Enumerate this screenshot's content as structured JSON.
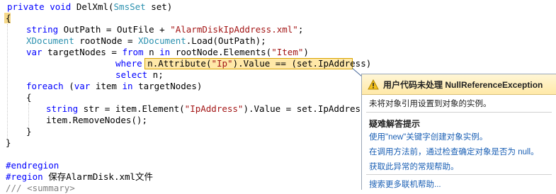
{
  "code": {
    "l1": {
      "a": "private void ",
      "b": "DelXml(",
      "c": "SmsSet",
      "d": " set)"
    },
    "l2": {
      "a": "{"
    },
    "l3": {
      "a": "string",
      "b": " OutPath = OutFile + ",
      "c": "\"AlarmDiskIpAddress.xml\"",
      "d": ";"
    },
    "l4": {
      "a": "XDocument",
      "b": " rootNode = ",
      "c": "XDocument",
      "d": ".Load(OutPath);"
    },
    "l5": {
      "a": "var",
      "b": " targetNodes = ",
      "c": "from",
      "d": " n ",
      "e": "in",
      "f": " rootNode.Elements(",
      "g": "\"Item\"",
      "h": ")"
    },
    "l6": {
      "a": "where",
      "b": " n.Attribute(",
      "c": "\"Ip\"",
      "d": ").Value == (set.IpAddress)"
    },
    "l7": {
      "a": "select",
      "b": " n;"
    },
    "l8": {
      "a": "foreach",
      "b": " (",
      "c": "var",
      "d": " item ",
      "e": "in",
      "f": " targetNodes)"
    },
    "l9": {
      "a": "{"
    },
    "l10": {
      "a": "string",
      "b": " str = item.Element(",
      "c": "\"IpAddress\"",
      "d": ").Value = set.IpAddress;"
    },
    "l11": {
      "a": "item.RemoveNodes();"
    },
    "l12": {
      "a": "}"
    },
    "l13": {
      "a": "}"
    },
    "l14": {
      "a": "#endregion"
    },
    "l15": {
      "a": "#region",
      "b": " 保存AlarmDisk.xml文件"
    },
    "l16": {
      "a": "/// <summary>"
    }
  },
  "exception": {
    "title": "用户代码未处理 NullReferenceException",
    "message": "未将对象引用设置到对象的实例。",
    "tips_title": "疑难解答提示",
    "tips": [
      "使用\"new\"关键字创建对象实例。",
      "在调用方法前，通过检查确定对象是否为 null。",
      "获取此异常的常规帮助。"
    ],
    "more_help": "搜索更多联机帮助..."
  },
  "colors": {
    "keyword": "#0000ff",
    "type": "#2b91af",
    "string": "#a31515",
    "highlight": "#ffe8a8",
    "link": "#1a5fb4"
  },
  "icons": {
    "warning": "warning-triangle-icon"
  }
}
